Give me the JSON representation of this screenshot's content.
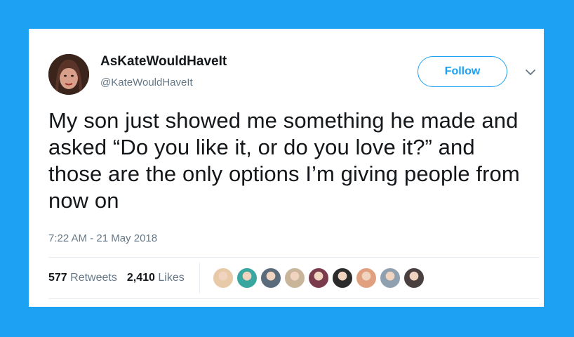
{
  "tweet": {
    "display_name": "AsKateWouldHaveIt",
    "handle": "@KateWouldHaveIt",
    "follow_label": "Follow",
    "text": "My son just showed me something he made and asked “Do you like it, or do you love it?” and those are the only options I’m giving people from now on",
    "timestamp": "7:22 AM - 21 May 2018",
    "retweets_count": "577",
    "retweets_label": "Retweets",
    "likes_count": "2,410",
    "likes_label": "Likes"
  },
  "colors": {
    "background": "#1da1f2",
    "accent": "#1da1f2",
    "text": "#14171a",
    "muted": "#657786"
  },
  "likers": [
    {
      "icon": "liker-avatar",
      "color": "#e8c9a8"
    },
    {
      "icon": "liker-avatar",
      "color": "#3aa6a0"
    },
    {
      "icon": "liker-avatar",
      "color": "#5a6b7c"
    },
    {
      "icon": "liker-avatar",
      "color": "#c9b59a"
    },
    {
      "icon": "liker-avatar",
      "color": "#7a3c4c"
    },
    {
      "icon": "liker-avatar",
      "color": "#2b2b2b"
    },
    {
      "icon": "liker-avatar",
      "color": "#e0a080"
    },
    {
      "icon": "liker-avatar",
      "color": "#8fa0b0"
    },
    {
      "icon": "liker-avatar",
      "color": "#4a4040"
    }
  ]
}
